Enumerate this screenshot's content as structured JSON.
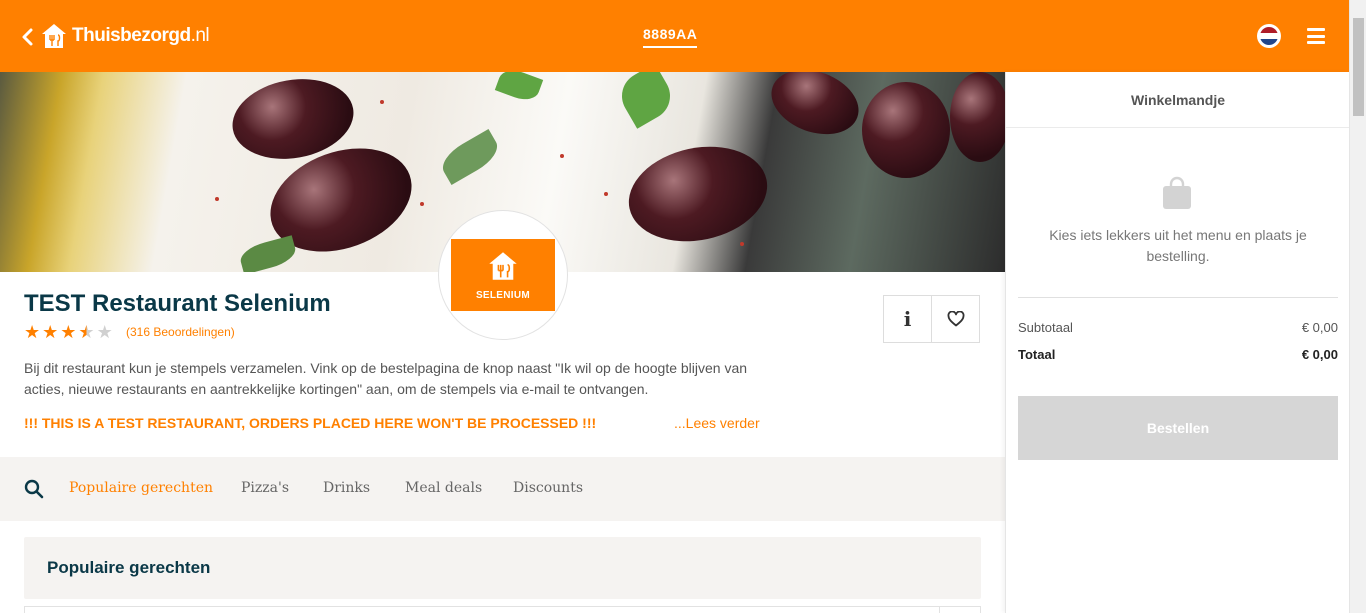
{
  "header": {
    "logo_text": "Thuisbezorgd",
    "logo_suffix": ".nl",
    "postcode": "8889AA"
  },
  "restaurant": {
    "name": "TEST Restaurant Selenium",
    "logo_label": "SELENIUM",
    "rating": 3.5,
    "rating_max": 5,
    "reviews": "(316 Beoordelingen)",
    "description": "Bij dit restaurant kun je stempels verzamelen. Vink op de bestelpagina de knop naast \"Ik wil op de hoogte blijven van acties, nieuwe restaurants en aantrekkelijke kortingen\" aan, om de stempels via e-mail te ontvangen.",
    "warning": "!!! THIS IS A TEST RESTAURANT, ORDERS PLACED HERE WON'T BE PROCESSED !!!",
    "read_more": "...Lees verder",
    "info_label": "i"
  },
  "categories": [
    "Populaire gerechten",
    "Pizza's",
    "Drinks",
    "Meal deals",
    "Discounts"
  ],
  "section": {
    "title": "Populaire gerechten"
  },
  "basket": {
    "title": "Winkelmandje",
    "empty_text": "Kies iets lekkers uit het menu en plaats je bestelling.",
    "subtotal_label": "Subtotaal",
    "subtotal_value": "€ 0,00",
    "total_label": "Totaal",
    "total_value": "€ 0,00",
    "order_button": "Bestellen"
  },
  "colors": {
    "brand": "#ff8000",
    "title": "#0a3847"
  }
}
